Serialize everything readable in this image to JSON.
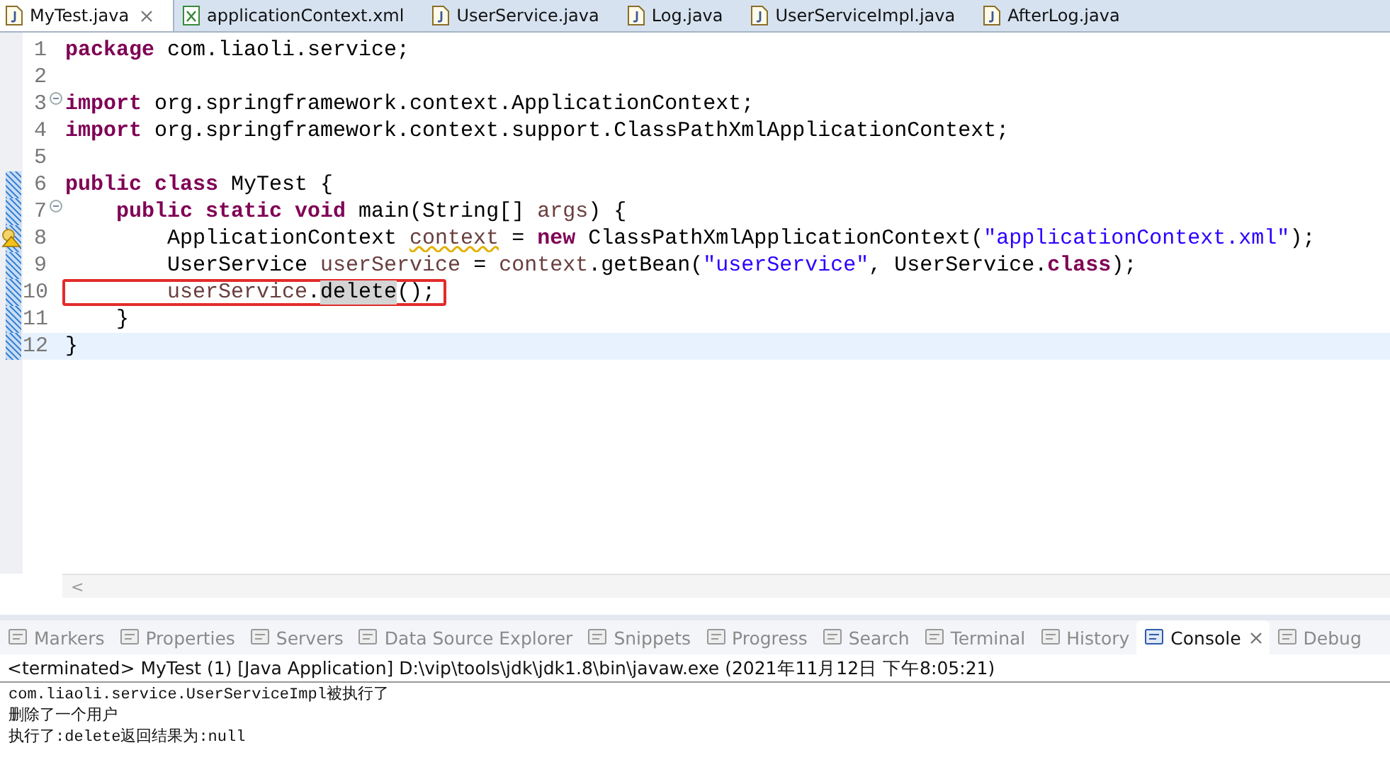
{
  "editor_tabs": [
    {
      "label": "MyTest.java",
      "kind": "java",
      "selected": true
    },
    {
      "label": "applicationContext.xml",
      "kind": "xml",
      "selected": false
    },
    {
      "label": "UserService.java",
      "kind": "java",
      "selected": false
    },
    {
      "label": "Log.java",
      "kind": "java",
      "selected": false
    },
    {
      "label": "UserServiceImpl.java",
      "kind": "java",
      "selected": false
    },
    {
      "label": "AfterLog.java",
      "kind": "java",
      "selected": false
    }
  ],
  "code_lines": [
    {
      "number": "1",
      "changed": false,
      "current": false,
      "fold": false,
      "warning": false,
      "boxed": false,
      "tokens": [
        {
          "kind": "keyword",
          "text": "package"
        },
        {
          "kind": "plain",
          "text": " com.liaoli.service;"
        }
      ]
    },
    {
      "number": "2",
      "changed": false,
      "current": false,
      "fold": false,
      "warning": false,
      "boxed": false
    },
    {
      "number": "3",
      "changed": false,
      "current": false,
      "fold": true,
      "warning": false,
      "boxed": false,
      "tokens": [
        {
          "kind": "keyword",
          "text": "import"
        },
        {
          "kind": "plain",
          "text": " org.springframework.context.ApplicationContext;"
        }
      ]
    },
    {
      "number": "4",
      "changed": false,
      "current": false,
      "fold": false,
      "warning": false,
      "boxed": false,
      "tokens": [
        {
          "kind": "keyword",
          "text": "import"
        },
        {
          "kind": "plain",
          "text": " org.springframework.context.support.ClassPathXmlApplicationContext;"
        }
      ]
    },
    {
      "number": "5",
      "changed": false,
      "current": false,
      "fold": false,
      "warning": false,
      "boxed": false
    },
    {
      "number": "6",
      "changed": true,
      "current": false,
      "fold": false,
      "warning": false,
      "boxed": false,
      "tokens": [
        {
          "kind": "keyword",
          "text": "public class"
        },
        {
          "kind": "plain",
          "text": " MyTest {"
        }
      ]
    },
    {
      "number": "7",
      "changed": true,
      "current": false,
      "fold": true,
      "warning": false,
      "boxed": false,
      "tokens": [
        {
          "kind": "keyword",
          "text": "    public static void"
        },
        {
          "kind": "plain",
          "text": " main(String[] "
        },
        {
          "kind": "variable",
          "text": "args"
        },
        {
          "kind": "plain",
          "text": ") {"
        }
      ]
    },
    {
      "number": "8",
      "changed": true,
      "current": false,
      "fold": false,
      "warning": true,
      "boxed": false,
      "tokens": [
        {
          "kind": "plain",
          "text": "        ApplicationContext "
        },
        {
          "kind": "warned",
          "text": "context"
        },
        {
          "kind": "plain",
          "text": " = "
        },
        {
          "kind": "keyword",
          "text": "new"
        },
        {
          "kind": "plain",
          "text": " ClassPathXmlApplicationContext("
        },
        {
          "kind": "string",
          "text": "\"applicationContext.xml\""
        },
        {
          "kind": "plain",
          "text": ");"
        }
      ]
    },
    {
      "number": "9",
      "changed": true,
      "current": false,
      "fold": false,
      "warning": false,
      "boxed": false,
      "tokens": [
        {
          "kind": "plain",
          "text": "        UserService "
        },
        {
          "kind": "variable",
          "text": "userService"
        },
        {
          "kind": "plain",
          "text": " = "
        },
        {
          "kind": "variable",
          "text": "context"
        },
        {
          "kind": "plain",
          "text": ".getBean("
        },
        {
          "kind": "string",
          "text": "\"userService\""
        },
        {
          "kind": "plain",
          "text": ", UserService."
        },
        {
          "kind": "keyword",
          "text": "class"
        },
        {
          "kind": "plain",
          "text": ");"
        }
      ]
    },
    {
      "number": "10",
      "changed": true,
      "current": false,
      "fold": false,
      "warning": false,
      "boxed": true,
      "tokens": [
        {
          "kind": "variable",
          "text": "        userService"
        },
        {
          "kind": "plain",
          "text": "."
        },
        {
          "kind": "occurrence",
          "text": "delete"
        },
        {
          "kind": "plain",
          "text": "();"
        }
      ]
    },
    {
      "number": "11",
      "changed": true,
      "current": false,
      "fold": false,
      "warning": false,
      "boxed": false,
      "tokens": [
        {
          "kind": "plain",
          "text": "    }"
        }
      ]
    },
    {
      "number": "12",
      "changed": true,
      "current": true,
      "fold": false,
      "warning": false,
      "boxed": false,
      "tokens": [
        {
          "kind": "plain",
          "text": "}"
        }
      ]
    }
  ],
  "scroll_left_arrow": "<",
  "panel_tabs": [
    {
      "label": "Markers",
      "selected": false
    },
    {
      "label": "Properties",
      "selected": false
    },
    {
      "label": "Servers",
      "selected": false
    },
    {
      "label": "Data Source Explorer",
      "selected": false
    },
    {
      "label": "Snippets",
      "selected": false
    },
    {
      "label": "Progress",
      "selected": false
    },
    {
      "label": "Search",
      "selected": false
    },
    {
      "label": "Terminal",
      "selected": false
    },
    {
      "label": "History",
      "selected": false
    },
    {
      "label": "Console",
      "selected": true
    },
    {
      "label": "Debug",
      "selected": false
    }
  ],
  "console": {
    "header": "<terminated> MyTest (1) [Java Application] D:\\vip\\tools\\jdk\\jdk1.8\\bin\\javaw.exe (2021年11月12日 下午8:05:21)",
    "output": [
      "com.liaoli.service.UserServiceImpl被执行了",
      "删除了一个用户",
      "执行了:delete返回结果为:null"
    ]
  }
}
